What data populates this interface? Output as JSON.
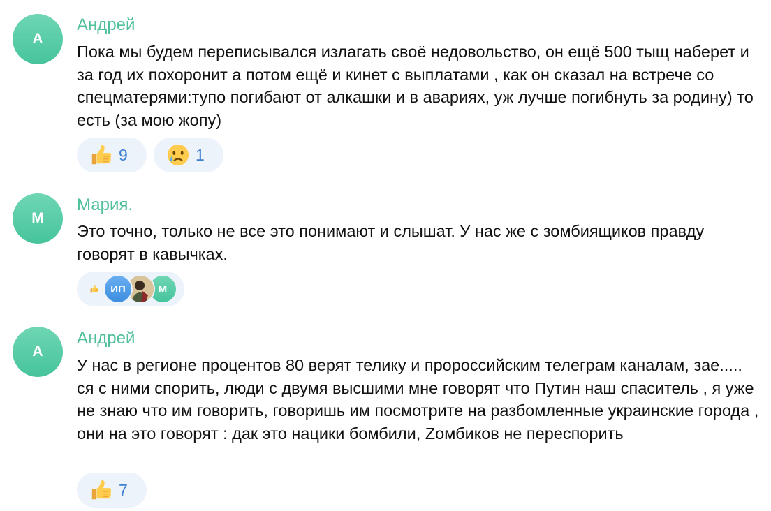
{
  "comments": [
    {
      "initial": "А",
      "author": "Андрей",
      "text": "Пока мы будем переписывался излагать своё недовольство, он ещё 500 тыщ наберет и  за год их похоронит а потом ещё и кинет с выплатами , как он сказал на встрече со спецматерями:тупо погибают от алкашки и в авариях, уж лучше погибнуть за родину) то есть (за мою жопу)",
      "reactions": [
        {
          "icon": "thumbs-up-icon",
          "count": "9"
        },
        {
          "icon": "crying-face-icon",
          "count": "1"
        }
      ]
    },
    {
      "initial": "М",
      "author": "Мария.",
      "text": "Это точно, только не все это понимают и слышат. У нас же с  зомбиящиков правду говорят в кавычках.",
      "reactions": [
        {
          "icon": "thumbs-up-icon",
          "voters": [
            "ИП",
            "",
            "М"
          ]
        }
      ]
    },
    {
      "initial": "А",
      "author": "Андрей",
      "text": "У нас в регионе процентов 80 верят телику и пророссийским телеграм каналам, зае..... ся с ними спорить, люди с двумя высшими мне говорят что Путин наш спаситель , я уже не знаю что им говорить, говоришь им посмотрите на разбомленные украинские города , они на это говорят : дак это нацики бомбили, Zомбиков не переспорить",
      "reactions": [
        {
          "icon": "thumbs-up-icon",
          "count": "7"
        }
      ]
    }
  ],
  "colors": {
    "accent": "#4fbf9c",
    "reaction_bg": "#edf3fb",
    "count": "#3d7fd1"
  }
}
